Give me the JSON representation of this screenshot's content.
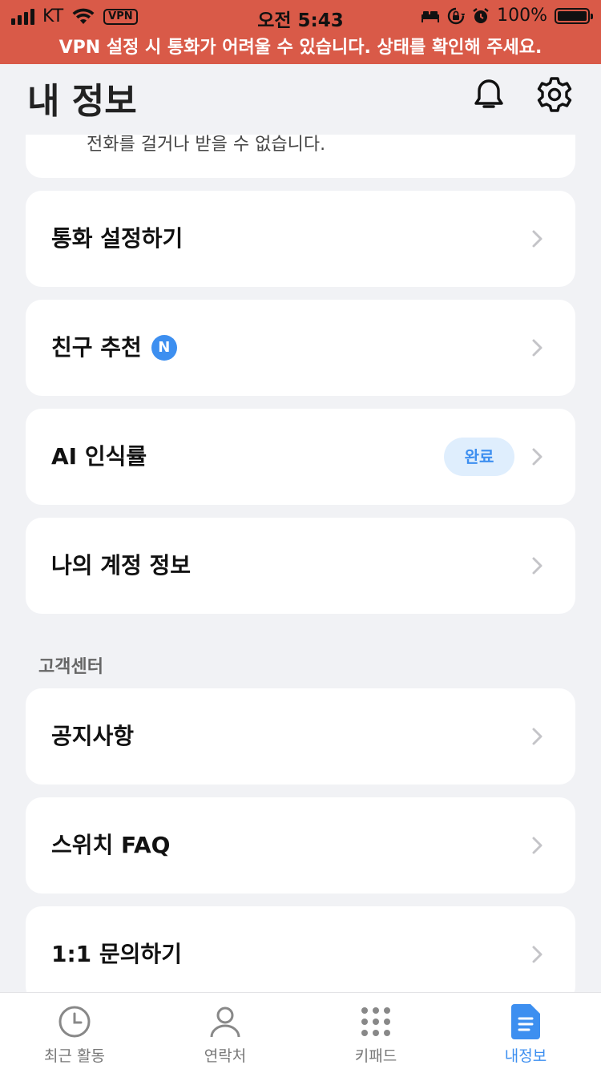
{
  "status_bar": {
    "carrier": "KT",
    "vpn": "VPN",
    "time": "오전 5:43",
    "battery": "100%"
  },
  "vpn_banner": "VPN 설정 시 통화가 어려울 수 있습니다. 상태를 확인해 주세요.",
  "header": {
    "title": "내 정보",
    "icons": [
      "bell-icon",
      "gear-icon"
    ]
  },
  "partial_card_text": "전화를 걸거나 받을 수 없습니다.",
  "menu": {
    "call_settings": "통화 설정하기",
    "friend_recommend": "친구 추천",
    "friend_badge": "N",
    "ai_recognition": "AI 인식률",
    "ai_status": "완료",
    "account_info": "나의 계정 정보"
  },
  "support": {
    "section_title": "고객센터",
    "notice": "공지사항",
    "faq": "스위치 FAQ",
    "inquiry": "1:1 문의하기"
  },
  "tabs": [
    {
      "label": "최근 활동",
      "icon": "clock-icon"
    },
    {
      "label": "연락처",
      "icon": "person-icon"
    },
    {
      "label": "키패드",
      "icon": "keypad-icon"
    },
    {
      "label": "내정보",
      "icon": "document-icon",
      "active": true
    }
  ],
  "colors": {
    "banner": "#d95a48",
    "accent": "#3d8ff0",
    "background": "#f1f2f5"
  }
}
